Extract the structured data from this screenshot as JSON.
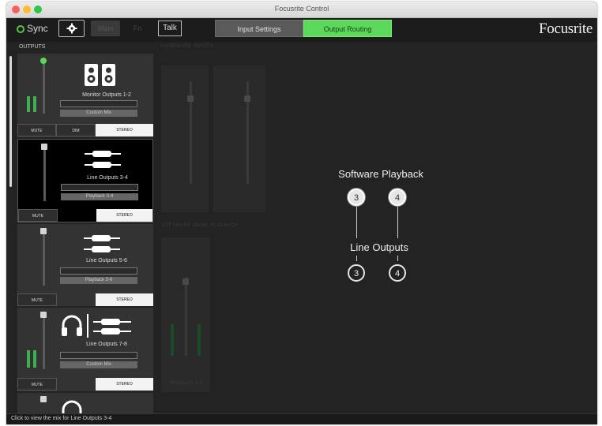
{
  "window": {
    "title": "Focusrite Control"
  },
  "toolbar": {
    "sync_label": "Sync",
    "main_label": "Main",
    "fn_label": "Fn",
    "talk_label": "Talk",
    "tabs": [
      {
        "label": "Input Settings"
      },
      {
        "label": "Output Routing"
      }
    ],
    "logo": "Focusrite"
  },
  "outputs": {
    "label": "OUTPUTS",
    "channels": [
      {
        "name": "Monitor Outputs 1-2",
        "mix": "Custom Mix",
        "buttons": [
          "MUTE",
          "DIM",
          "STEREO"
        ]
      },
      {
        "name": "Line Outputs 3-4",
        "mix": "Playback 3-4",
        "buttons": [
          "MUTE",
          "STEREO"
        ]
      },
      {
        "name": "Line Outputs 5-6",
        "mix": "Playback 5-6",
        "buttons": [
          "MUTE",
          "STEREO"
        ]
      },
      {
        "name": "Line Outputs 7-8",
        "mix": "Custom Mix",
        "buttons": [
          "MUTE",
          "STEREO"
        ]
      }
    ]
  },
  "background_panels": {
    "hardware_inputs": "HARDWARE INPUTS",
    "software_playback": "SOFTWARE (DAW) PLAYBACK",
    "playback_label": "Playback 1-2"
  },
  "routing": {
    "source_title": "Software Playback",
    "dest_title": "Line Outputs",
    "sources": [
      "3",
      "4"
    ],
    "destinations": [
      "3",
      "4"
    ]
  },
  "status": {
    "text": "Click to view the mix for Line Outputs 3-4"
  },
  "colors": {
    "accent_green": "#5cd95a",
    "meter_green": "#3fb050"
  }
}
